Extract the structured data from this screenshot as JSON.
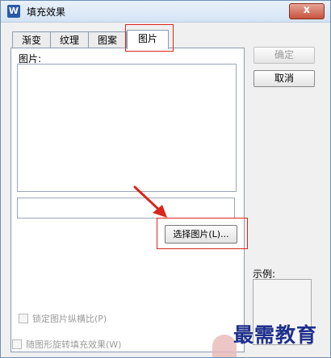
{
  "window": {
    "title": "填充效果",
    "app_icon_letter": "W",
    "close_glyph": "x"
  },
  "tabs": [
    {
      "label": "渐变"
    },
    {
      "label": "纹理"
    },
    {
      "label": "图案"
    },
    {
      "label": "图片",
      "active": true
    }
  ],
  "panel": {
    "picture_label": "图片:",
    "select_button_label": "选择图片(L)...",
    "lock_aspect_label": "锁定图片纵横比(P)",
    "rotate_with_shape_label": "随图形旋转填充效果(W)"
  },
  "side": {
    "ok_label": "确定",
    "cancel_label": "取消",
    "sample_label": "示例:"
  },
  "watermark": {
    "text": "最需教育"
  },
  "colors": {
    "highlight": "#d9261c",
    "watermark": "#1e2f8c"
  }
}
